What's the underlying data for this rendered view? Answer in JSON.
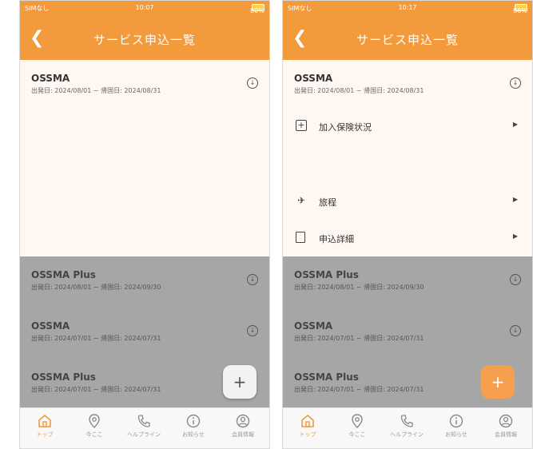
{
  "status_left": {
    "carrier": "SIMなし",
    "time": "10:07",
    "battery": "80%"
  },
  "status_right": {
    "carrier": "SIMなし",
    "time": "10:17",
    "battery": "86%"
  },
  "header": {
    "title": "サービス申込一覧",
    "back_icon": "chevron-left-icon"
  },
  "colors": {
    "accent": "#f39a3c",
    "dim": "#a6a6a6"
  },
  "left_screen": {
    "expanded_card": {
      "title": "OSSMA",
      "dates": "出発日: 2024/08/01 ~ 帰国日: 2024/08/31"
    },
    "cards": [
      {
        "title": "OSSMA Plus",
        "dates": "出発日: 2024/08/01 ~ 帰国日: 2024/09/30"
      },
      {
        "title": "OSSMA",
        "dates": "出発日: 2024/07/01 ~ 帰国日: 2024/07/31"
      },
      {
        "title": "OSSMA Plus",
        "dates": "出発日: 2024/07/01 ~ 帰国日: 2024/07/31"
      }
    ],
    "fab": "+"
  },
  "right_screen": {
    "expanded_card": {
      "title": "OSSMA",
      "dates": "出発日: 2024/08/01 ~ 帰国日: 2024/08/31",
      "menu": [
        {
          "label": "加入保険状況",
          "icon": "plus-square-icon"
        },
        {
          "label": "旅程",
          "icon": "airplane-icon"
        },
        {
          "label": "申込詳細",
          "icon": "book-icon"
        }
      ]
    },
    "cards": [
      {
        "title": "OSSMA Plus",
        "dates": "出発日: 2024/08/01 ~ 帰国日: 2024/09/30"
      },
      {
        "title": "OSSMA",
        "dates": "出発日: 2024/07/01 ~ 帰国日: 2024/07/31"
      },
      {
        "title": "OSSMA Plus",
        "dates": "出発日: 2024/07/01 ~ 帰国日: 2024/07/31"
      }
    ],
    "fab": "+"
  },
  "tabbar": {
    "items": [
      {
        "label": "トップ",
        "icon": "home-icon"
      },
      {
        "label": "今ここ",
        "icon": "location-pin-icon"
      },
      {
        "label": "ヘルプライン",
        "icon": "phone-icon"
      },
      {
        "label": "お知らせ",
        "icon": "info-icon"
      },
      {
        "label": "会員情報",
        "icon": "user-icon"
      }
    ]
  }
}
